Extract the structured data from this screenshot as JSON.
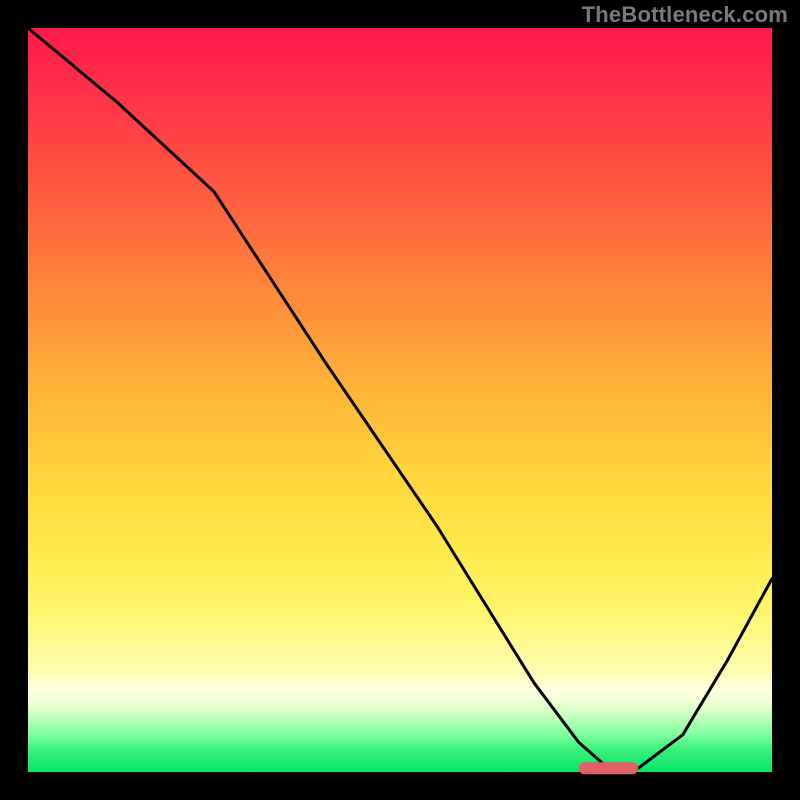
{
  "watermark": "TheBottleneck.com",
  "chart_data": {
    "type": "line",
    "title": "",
    "xlabel": "",
    "ylabel": "",
    "xlim": [
      0,
      100
    ],
    "ylim": [
      0,
      100
    ],
    "series": [
      {
        "name": "bottleneck-curve",
        "x": [
          0,
          12,
          25,
          40,
          55,
          68,
          74,
          78,
          82,
          88,
          94,
          100
        ],
        "values": [
          100,
          90,
          78,
          55,
          33,
          12,
          4,
          0.5,
          0.5,
          5,
          15,
          26
        ]
      }
    ],
    "marker": {
      "name": "optimal-range",
      "x_start": 74,
      "x_end": 82,
      "y": 0.5
    },
    "background": {
      "top_color": "#ff1a4b",
      "mid_color": "#ffe94a",
      "bottom_color": "#05e566"
    }
  }
}
